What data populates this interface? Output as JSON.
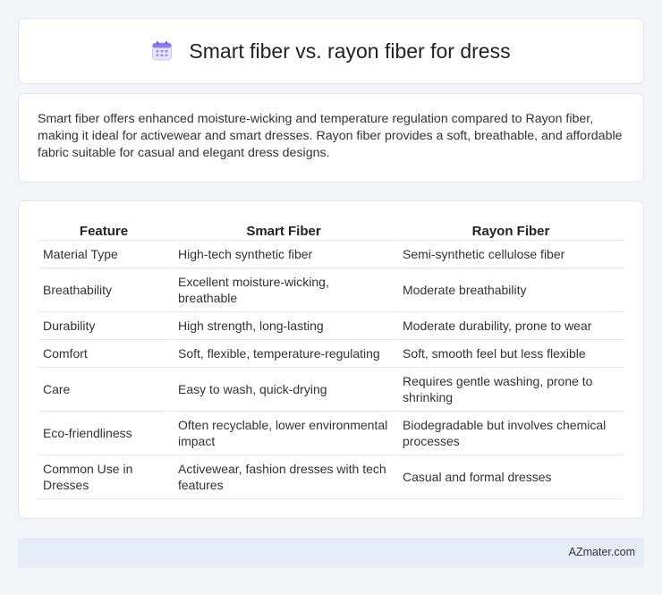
{
  "header": {
    "title": "Smart fiber vs. rayon fiber for dress",
    "icon": "calendar-icon"
  },
  "summary": {
    "text": "Smart fiber offers enhanced moisture-wicking and temperature regulation compared to Rayon fiber, making it ideal for activewear and smart dresses. Rayon fiber provides a soft, breathable, and affordable fabric suitable for casual and elegant dress designs."
  },
  "table": {
    "columns": [
      "Feature",
      "Smart Fiber",
      "Rayon Fiber"
    ],
    "rows": [
      [
        "Material Type",
        "High-tech synthetic fiber",
        "Semi-synthetic cellulose fiber"
      ],
      [
        "Breathability",
        "Excellent moisture-wicking, breathable",
        "Moderate breathability"
      ],
      [
        "Durability",
        "High strength, long-lasting",
        "Moderate durability, prone to wear"
      ],
      [
        "Comfort",
        "Soft, flexible, temperature-regulating",
        "Soft, smooth feel but less flexible"
      ],
      [
        "Care",
        "Easy to wash, quick-drying",
        "Requires gentle washing, prone to shrinking"
      ],
      [
        "Eco-friendliness",
        "Often recyclable, lower environmental impact",
        "Biodegradable but involves chemical processes"
      ],
      [
        "Common Use in Dresses",
        "Activewear, fashion dresses with tech features",
        "Casual and formal dresses"
      ]
    ]
  },
  "footer": {
    "brand": "AZmater.com"
  }
}
